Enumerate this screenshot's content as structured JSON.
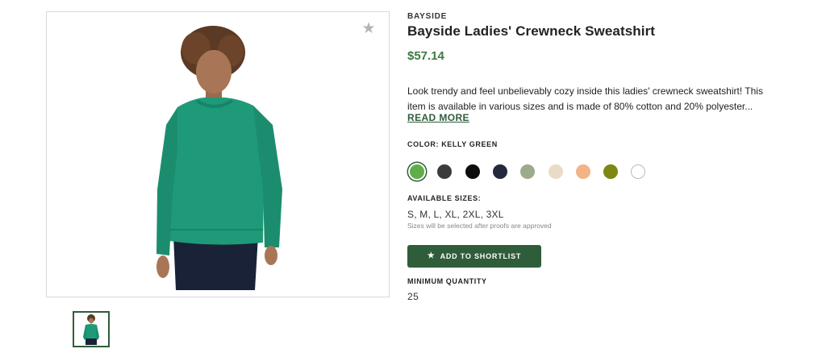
{
  "product": {
    "brand": "BAYSIDE",
    "title": "Bayside Ladies' Crewneck Sweatshirt",
    "price": "$57.14",
    "description": "Look trendy and feel unbelievably cozy inside this ladies' crewneck sweatshirt! This item is available in various sizes and is made of 80% cotton and 20% polyester...",
    "read_more_label": "READ MORE"
  },
  "icons": {
    "favorite": "star-icon",
    "shortlist": "star-icon"
  },
  "color": {
    "label": "COLOR: KELLY GREEN",
    "selected_index": 0,
    "swatches": [
      {
        "name": "kelly-green",
        "hex": "#5fae4a"
      },
      {
        "name": "charcoal",
        "hex": "#3a3b3d"
      },
      {
        "name": "black",
        "hex": "#0d0d0d"
      },
      {
        "name": "navy",
        "hex": "#242a3b"
      },
      {
        "name": "sage",
        "hex": "#9bab8d"
      },
      {
        "name": "cream",
        "hex": "#eadcc4"
      },
      {
        "name": "peach",
        "hex": "#f2b487"
      },
      {
        "name": "olive",
        "hex": "#7d8712"
      },
      {
        "name": "white",
        "hex": "#ffffff"
      }
    ]
  },
  "sizes": {
    "label": "AVAILABLE SIZES:",
    "value": "S, M, L, XL, 2XL, 3XL",
    "note": "Sizes will be selected after proofs are approved"
  },
  "actions": {
    "shortlist_label": "ADD TO SHORTLIST"
  },
  "minimum": {
    "label": "MINIMUM QUANTITY",
    "value": "25"
  },
  "colors": {
    "accent": "#2f5d3a",
    "price": "#3d7a45",
    "sweatshirt": "#1e9a78"
  }
}
